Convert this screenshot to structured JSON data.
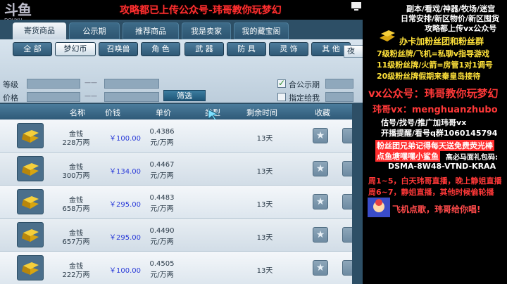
{
  "overlay": {
    "logo_big": "斗鱼",
    "logo_small": "DOUYU",
    "title": "攻略都已上传公众号-玮哥教你玩梦幻"
  },
  "right_panel": {
    "lines_top": [
      "副本/看戏/神器/牧场/迷宫",
      "日常安排/新区物价/新区囤货",
      "攻略都上传vx公众号"
    ],
    "join": "办卡加粉丝团和粉丝群",
    "fan_lines": [
      "7级粉丝牌/飞机=私聊v指导游戏",
      "11级粉丝牌/火箭=房管1对1调号",
      "20级粉丝牌假期来秦皇岛接待"
    ],
    "vx_public": "vx公众号：玮哥教你玩梦幻",
    "vx": "玮哥vx：menghuanzhubo",
    "estimate": "估号/找号/推广加玮哥vx",
    "live_remind": "开播提醒/看号q群1060145794",
    "fan_gift_1": "粉丝团兄弟记得每天送免费荧光棒",
    "fan_gift_2": "点鱼塘嘿嘿小鲨鱼",
    "gift_code_label": "高必马面礼包码:",
    "gift_code": "DSMA-8W48-VTND-KRAA",
    "schedule_1": "周1~5，白天玮哥直播，晚上静姐直播",
    "schedule_2": "周6~7，静姐直播，其他时候偷轮播",
    "footer": "飞机点歌，玮哥给你唱!"
  },
  "tabs": [
    "寄货商品",
    "公示期",
    "推荐商品",
    "我是卖家",
    "我的藏宝阁"
  ],
  "categories": [
    "全 部",
    "梦幻币",
    "召唤兽",
    "角 色",
    "武 器",
    "防 具",
    "灵 饰",
    "其 他"
  ],
  "filters": {
    "level_label": "等级",
    "price_label": "价格",
    "dash": "——",
    "public_label": "合公示期",
    "seller_label": "指定给我",
    "filter_button": "筛选",
    "right_partial": "夜"
  },
  "table": {
    "headers": [
      "名称",
      "价钱",
      "单价",
      "类型",
      "剩余时间",
      "收藏"
    ],
    "rows": [
      {
        "name": "金钱",
        "amount": "228万两",
        "price": "￥100.00",
        "unit": "0.4386",
        "unit2": "元/万两",
        "time": "13天"
      },
      {
        "name": "金钱",
        "amount": "300万两",
        "price": "￥134.00",
        "unit": "0.4467",
        "unit2": "元/万两",
        "time": "13天"
      },
      {
        "name": "金钱",
        "amount": "658万两",
        "price": "￥295.00",
        "unit": "0.4483",
        "unit2": "元/万两",
        "time": "13天"
      },
      {
        "name": "金钱",
        "amount": "657万两",
        "price": "￥295.00",
        "unit": "0.4490",
        "unit2": "元/万两",
        "time": "13天"
      },
      {
        "name": "金钱",
        "amount": "222万两",
        "price": "￥100.00",
        "unit": "0.4505",
        "unit2": "元/万两",
        "time": "13天"
      }
    ]
  },
  "colors": {
    "accent_red": "#ff3838",
    "accent_yellow": "#ffe23a",
    "price_blue": "#2a3bd8",
    "game_bg": "#2d4f66"
  }
}
